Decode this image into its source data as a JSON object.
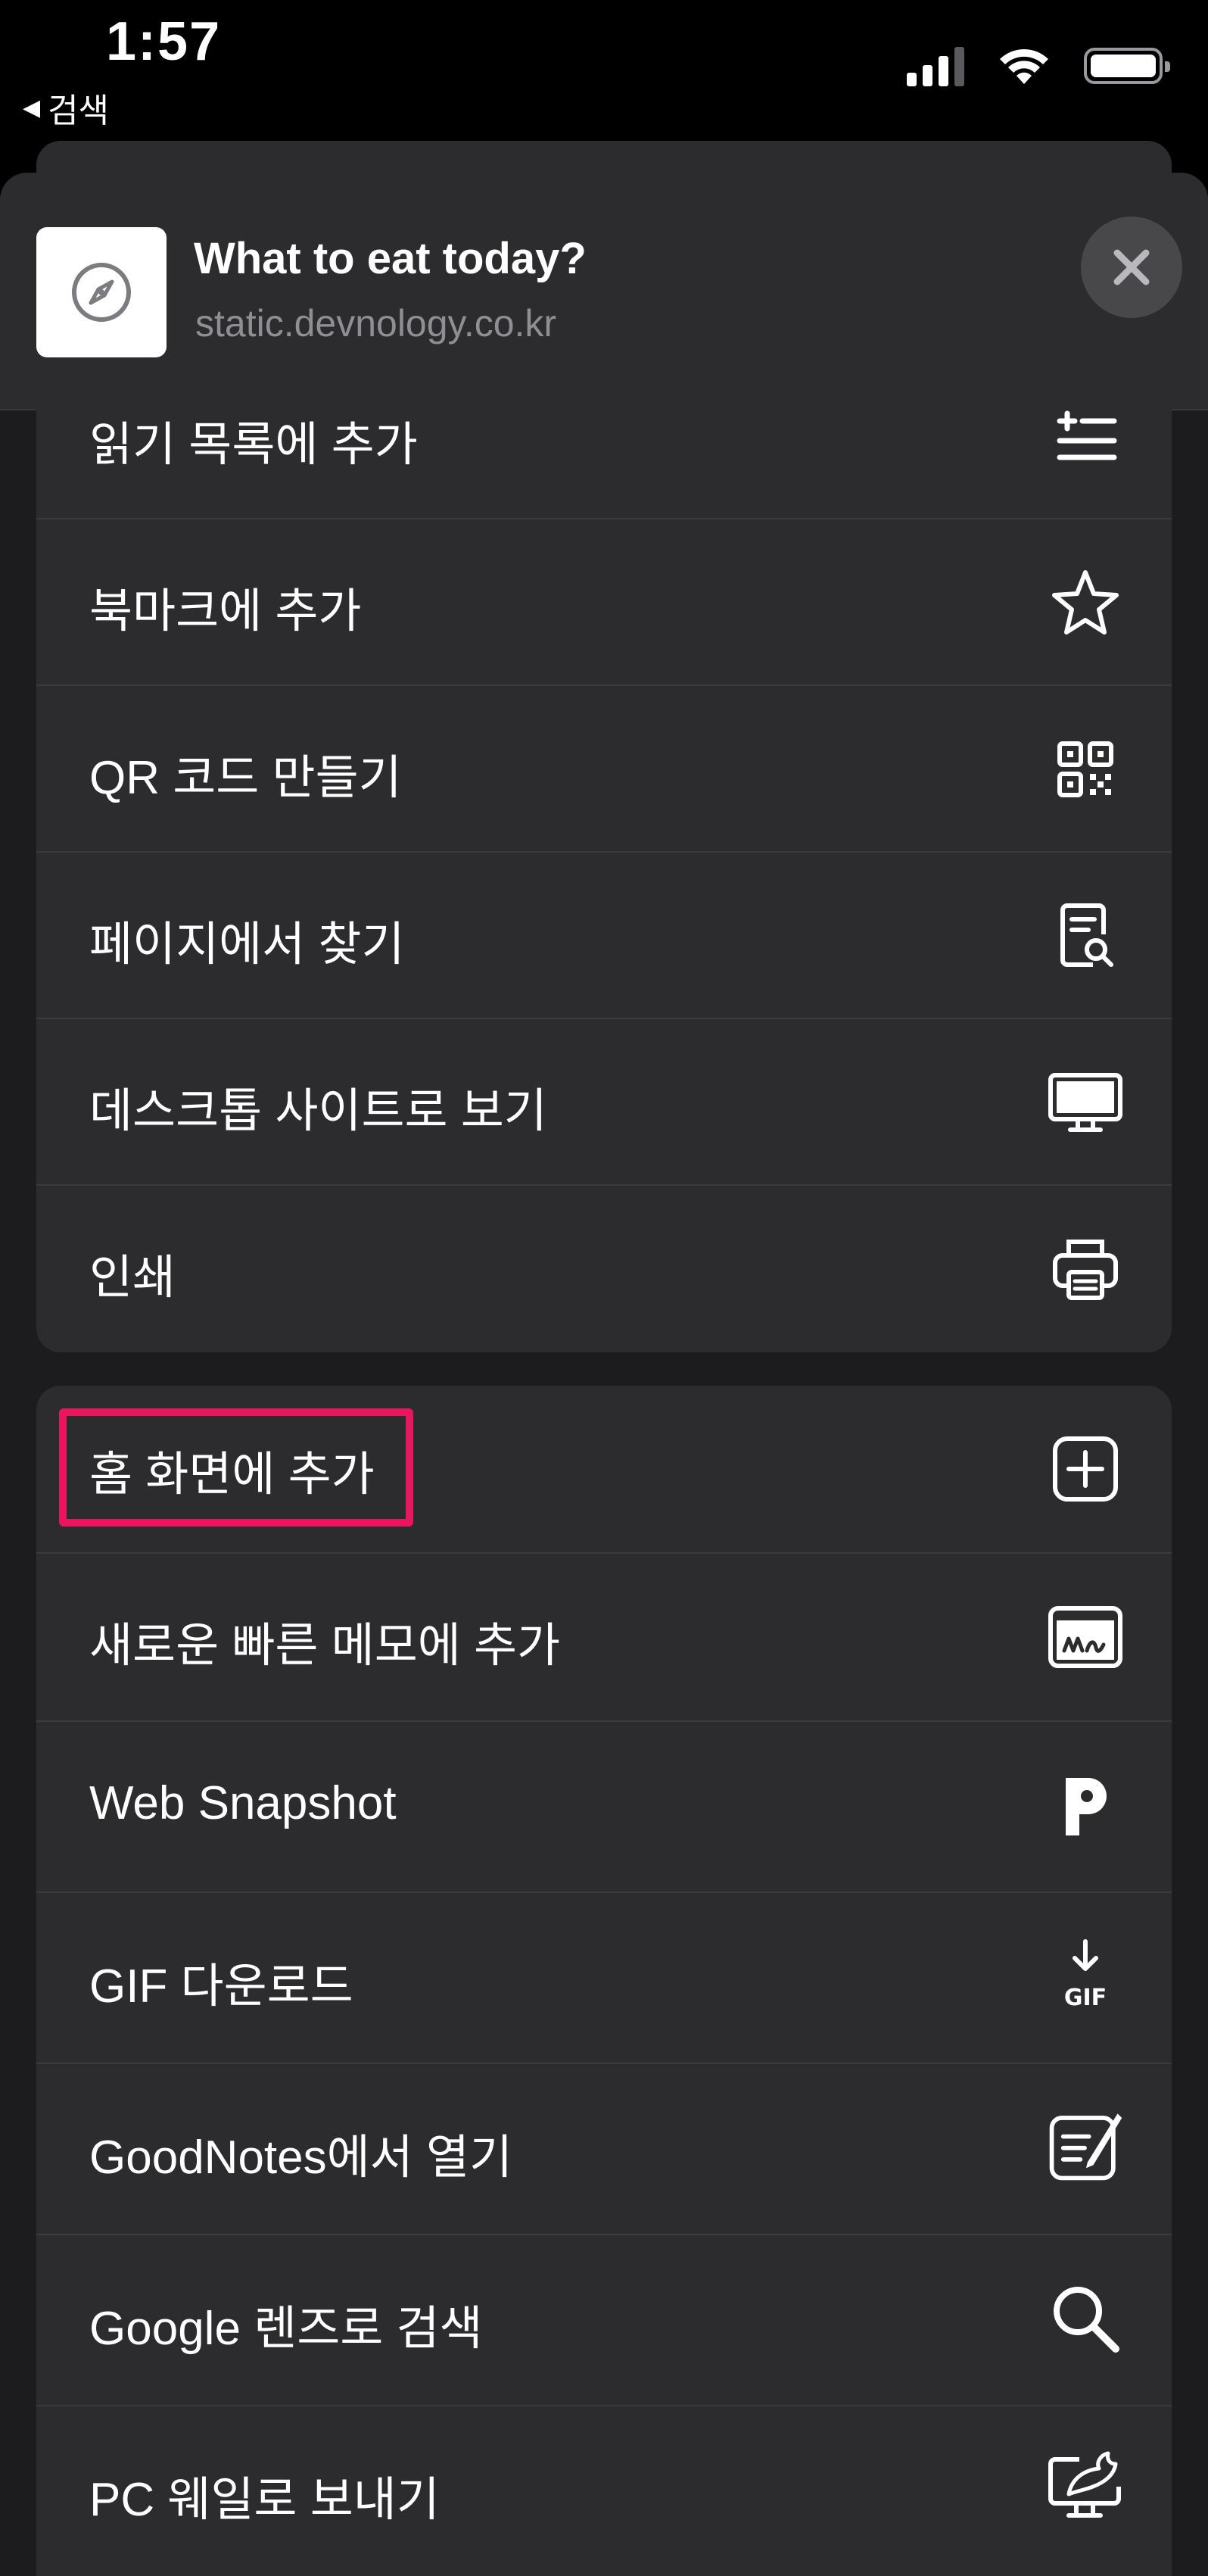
{
  "status_bar": {
    "time": "1:57",
    "back_label": "검색",
    "back_arrow": "◀"
  },
  "header": {
    "title": "What to eat today?",
    "url": "static.devnology.co.kr",
    "site_icon": "compass-icon",
    "close_icon": "close-icon"
  },
  "group1": {
    "items": [
      {
        "label": "읽기 목록에 추가",
        "icon": "reading-list-add-icon"
      },
      {
        "label": "북마크에 추가",
        "icon": "star-icon"
      },
      {
        "label": "QR 코드 만들기",
        "icon": "qr-code-icon"
      },
      {
        "label": "페이지에서 찾기",
        "icon": "find-on-page-icon"
      },
      {
        "label": "데스크톱 사이트로 보기",
        "icon": "desktop-icon"
      },
      {
        "label": "인쇄",
        "icon": "printer-icon"
      }
    ]
  },
  "group2": {
    "items": [
      {
        "label": "홈 화면에 추가",
        "icon": "add-square-icon",
        "highlighted": true
      },
      {
        "label": "새로운 빠른 메모에 추가",
        "icon": "quick-note-icon"
      },
      {
        "label": "Web Snapshot",
        "icon": "web-snapshot-p-icon"
      },
      {
        "label": "GIF 다운로드",
        "icon": "gif-download-icon",
        "icon_text": "GIF"
      },
      {
        "label": "GoodNotes에서 열기",
        "icon": "goodnotes-icon"
      },
      {
        "label": "Google 렌즈로 검색",
        "icon": "search-icon"
      },
      {
        "label": "PC 웨일로 보내기",
        "icon": "whale-send-icon"
      }
    ]
  },
  "colors": {
    "background": "#000000",
    "sheet": "#1c1c1e",
    "row": "#2c2c2e",
    "separator": "#3c3c40",
    "secondary_text": "#8e8e93",
    "highlight": "#e8175d"
  }
}
